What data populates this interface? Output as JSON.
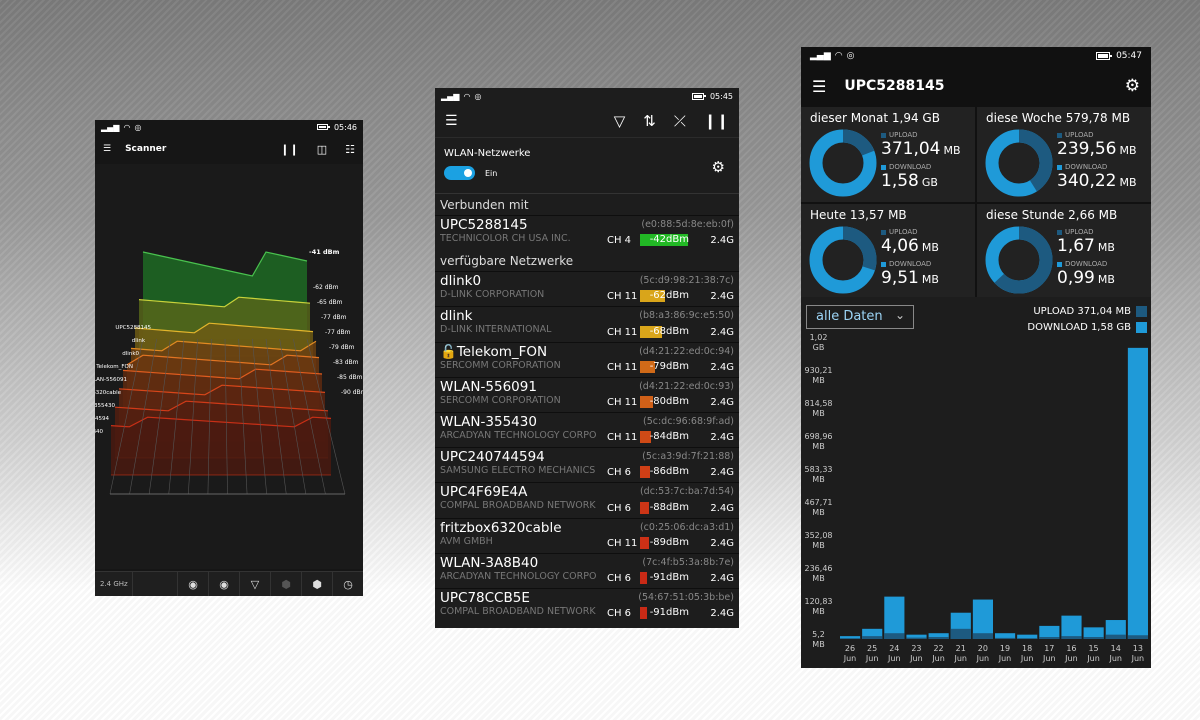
{
  "scanner": {
    "status": {
      "time": "05:46"
    },
    "title": "Scanner",
    "labels": [
      "UPC5288145",
      "dlink",
      "dlink0",
      "Telekom_FON",
      "WLAN-556091",
      "box6320cable",
      "N-355430",
      "744594",
      "8B40"
    ],
    "dbm_labels": [
      "-41 dBm",
      "-62 dBm",
      "-65 dBm",
      "-77 dBm",
      "-77 dBm",
      "-79 dBm",
      "-83 dBm",
      "-85 dBm",
      "-90 dBm"
    ],
    "band": "2.4 GHz"
  },
  "wlan": {
    "status": {
      "time": "05:45"
    },
    "title": "WLAN-Netzwerke",
    "toggle_label": "Ein",
    "connected_header": "Verbunden mit",
    "available_header": "verfügbare Netzwerke",
    "connected": {
      "ssid": "UPC5288145",
      "mac": "(e0:88:5d:8e:eb:0f)",
      "vendor": "TECHNICOLOR CH USA INC.",
      "channel": "CH 4",
      "signal": "-42dBm",
      "level": 0.72,
      "color": "#22b825",
      "band": "2.4G"
    },
    "networks": [
      {
        "ssid": "dlink0",
        "mac": "(5c:d9:98:21:38:7c)",
        "vendor": "D-LINK CORPORATION",
        "channel": "CH 11",
        "signal": "-62dBm",
        "level": 0.38,
        "color": "#d9a51a",
        "band": "2.4G",
        "lock": ""
      },
      {
        "ssid": "dlink",
        "mac": "(b8:a3:86:9c:e5:50)",
        "vendor": "D-LINK INTERNATIONAL",
        "channel": "CH 11",
        "signal": "-68dBm",
        "level": 0.33,
        "color": "#d9a51a",
        "band": "2.4G",
        "lock": ""
      },
      {
        "ssid": "Telekom_FON",
        "mac": "(d4:21:22:ed:0c:94)",
        "vendor": "SERCOMM CORPORATION",
        "channel": "CH 11",
        "signal": "-79dBm",
        "level": 0.22,
        "color": "#d06a18",
        "band": "2.4G",
        "lock": "🔓"
      },
      {
        "ssid": "WLAN-556091",
        "mac": "(d4:21:22:ed:0c:93)",
        "vendor": "SERCOMM CORPORATION",
        "channel": "CH 11",
        "signal": "-80dBm",
        "level": 0.2,
        "color": "#d06018",
        "band": "2.4G",
        "lock": ""
      },
      {
        "ssid": "WLAN-355430",
        "mac": "(5c:dc:96:68:9f:ad)",
        "vendor": "ARCADYAN TECHNOLOGY CORPO",
        "channel": "CH 11",
        "signal": "-84dBm",
        "level": 0.17,
        "color": "#cf4a16",
        "band": "2.4G",
        "lock": ""
      },
      {
        "ssid": "UPC240744594",
        "mac": "(5c:a3:9d:7f:21:88)",
        "vendor": "SAMSUNG ELECTRO MECHANICS",
        "channel": "CH 6",
        "signal": "-86dBm",
        "level": 0.15,
        "color": "#cf3f16",
        "band": "2.4G",
        "lock": ""
      },
      {
        "ssid": "UPC4F69E4A",
        "mac": "(dc:53:7c:ba:7d:54)",
        "vendor": "COMPAL BROADBAND NETWORK",
        "channel": "CH 6",
        "signal": "-88dBm",
        "level": 0.14,
        "color": "#cc3516",
        "band": "2.4G",
        "lock": ""
      },
      {
        "ssid": "fritzbox6320cable",
        "mac": "(c0:25:06:dc:a3:d1)",
        "vendor": "AVM GMBH",
        "channel": "CH 11",
        "signal": "-89dBm",
        "level": 0.13,
        "color": "#cc3016",
        "band": "2.4G",
        "lock": ""
      },
      {
        "ssid": "WLAN-3A8B40",
        "mac": "(7c:4f:b5:3a:8b:7e)",
        "vendor": "ARCADYAN TECHNOLOGY CORPO",
        "channel": "CH 6",
        "signal": "-91dBm",
        "level": 0.11,
        "color": "#c92a16",
        "band": "2.4G",
        "lock": ""
      },
      {
        "ssid": "UPC78CCB5E",
        "mac": "(54:67:51:05:3b:be)",
        "vendor": "COMPAL BROADBAND NETWORK",
        "channel": "CH 6",
        "signal": "-91dBm",
        "level": 0.11,
        "color": "#c92a16",
        "band": "2.4G",
        "lock": ""
      }
    ]
  },
  "stats": {
    "status": {
      "time": "05:47"
    },
    "title": "UPC5288145",
    "upload_label": "UPLOAD",
    "download_label": "DOWNLOAD",
    "colors": {
      "upload": "#1d5a80",
      "download": "#1f9ad8"
    },
    "tiles": [
      {
        "title": "dieser Monat 1,94 GB",
        "upload": "371,04",
        "upload_unit": "MB",
        "download": "1,58",
        "download_unit": "GB",
        "upload_share": 0.19
      },
      {
        "title": "diese Woche 579,78 MB",
        "upload": "239,56",
        "upload_unit": "MB",
        "download": "340,22",
        "download_unit": "MB",
        "upload_share": 0.41
      },
      {
        "title": "Heute 13,57 MB",
        "upload": "4,06",
        "upload_unit": "MB",
        "download": "9,51",
        "download_unit": "MB",
        "upload_share": 0.3
      },
      {
        "title": "diese Stunde 2,66 MB",
        "upload": "1,67",
        "upload_unit": "MB",
        "download": "0,99",
        "download_unit": "MB",
        "upload_share": 0.63
      }
    ],
    "filter": "alle Daten",
    "legend_upload": "UPLOAD 371,04 MB",
    "legend_download": "DOWNLOAD 1,58 GB",
    "y_ticks": [
      [
        "1,02",
        "GB"
      ],
      [
        "930,21",
        "MB"
      ],
      [
        "814,58",
        "MB"
      ],
      [
        "698,96",
        "MB"
      ],
      [
        "583,33",
        "MB"
      ],
      [
        "467,71",
        "MB"
      ],
      [
        "352,08",
        "MB"
      ],
      [
        "236,46",
        "MB"
      ],
      [
        "120,83",
        "MB"
      ],
      [
        "5,2",
        "MB"
      ]
    ]
  },
  "chart_data": {
    "type": "bar",
    "categories": [
      "26 Jun",
      "25 Jun",
      "24 Jun",
      "23 Jun",
      "22 Jun",
      "21 Jun",
      "20 Jun",
      "19 Jun",
      "18 Jun",
      "17 Jun",
      "16 Jun",
      "15 Jun",
      "14 Jun",
      "13 Jun"
    ],
    "series": [
      {
        "name": "UPLOAD",
        "values": [
          8,
          15,
          25,
          10,
          12,
          40,
          25,
          9,
          8,
          12,
          15,
          12,
          20,
          18
        ]
      },
      {
        "name": "DOWNLOAD",
        "values": [
          15,
          40,
          150,
          20,
          25,
          95,
          140,
          25,
          20,
          50,
          85,
          45,
          70,
          1000
        ]
      }
    ],
    "ylim": [
      5.2,
      1020
    ]
  }
}
